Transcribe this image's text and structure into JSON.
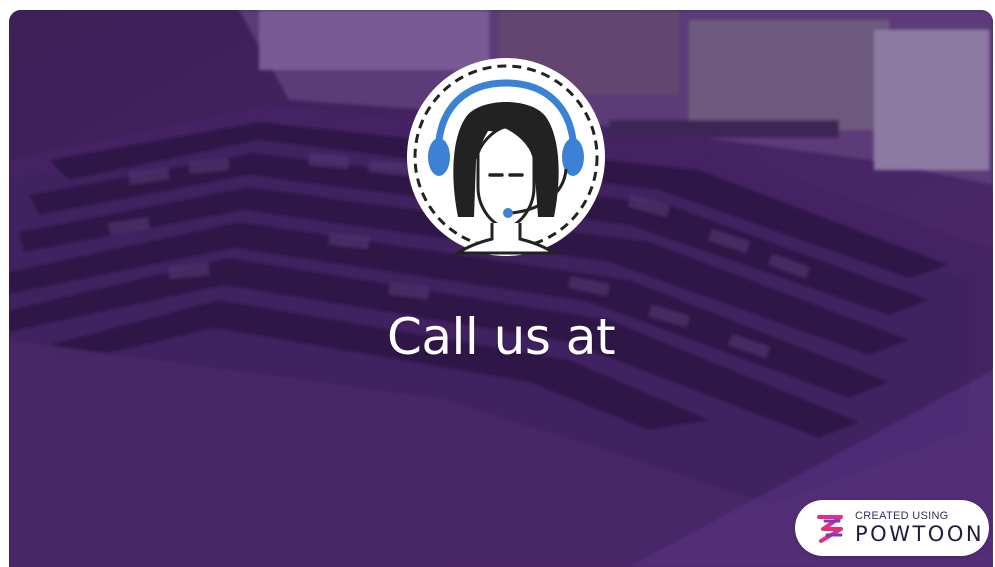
{
  "headline": "Call us at",
  "badge": {
    "created_label": "CREATED USING",
    "brand_label": "POWTOON"
  },
  "colors": {
    "overlay": "#4a2668",
    "accent_blue": "#3b82d6",
    "badge_logo_pink": "#e0317e",
    "badge_logo_purple": "#6d3bd6"
  },
  "icons": {
    "center": "support-agent-headset-icon",
    "badge": "powtoon-logo-icon"
  }
}
